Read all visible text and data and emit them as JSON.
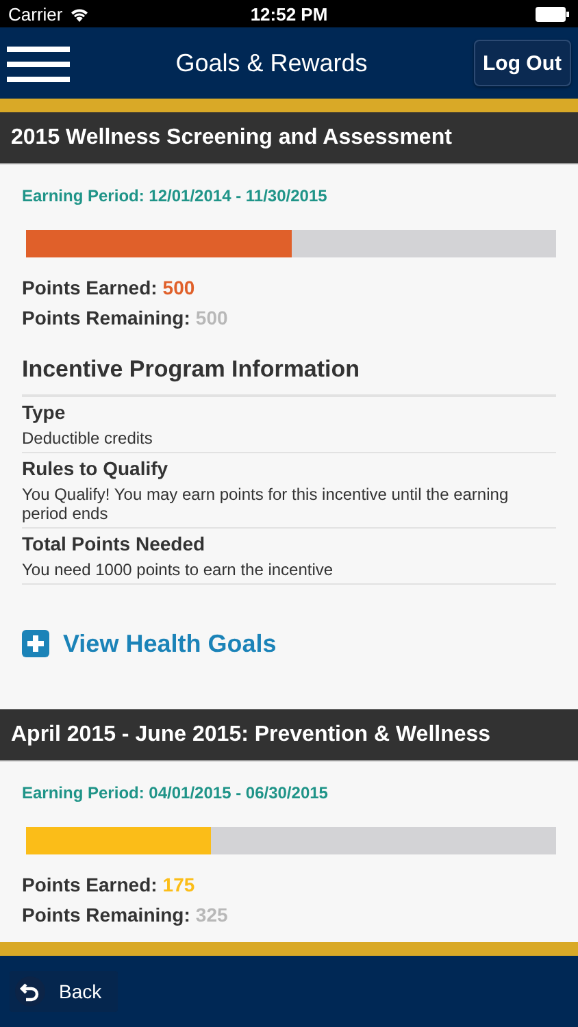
{
  "status_bar": {
    "carrier": "Carrier",
    "time": "12:52 PM"
  },
  "nav": {
    "title": "Goals & Rewards",
    "logout": "Log Out"
  },
  "programs": [
    {
      "title": "2015 Wellness Screening and Assessment",
      "period": "Earning Period: 12/01/2014 - 11/30/2015",
      "level": 0.5,
      "color": "#e0602a",
      "earned_label": "Points Earned:",
      "earned": "500",
      "remaining_label": "Points Remaining:",
      "remaining": "500",
      "info": {
        "heading": "Incentive Program Information",
        "rows": [
          {
            "label": "Type",
            "value": "Deductible credits"
          },
          {
            "label": "Rules to Qualify",
            "value": "You Qualify! You may earn points for this incentive until the earning period ends"
          },
          {
            "label": "Total Points Needed",
            "value": "You need 1000 points to earn the incentive"
          }
        ]
      },
      "link": "View Health Goals"
    },
    {
      "title": "April 2015 - June 2015: Prevention & Wellness",
      "period": "Earning Period: 04/01/2015 - 06/30/2015",
      "level": 0.35,
      "color": "#fbbd18",
      "earned_label": "Points Earned:",
      "earned": "175",
      "remaining_label": "Points Remaining:",
      "remaining": "325"
    }
  ],
  "back": "Back"
}
